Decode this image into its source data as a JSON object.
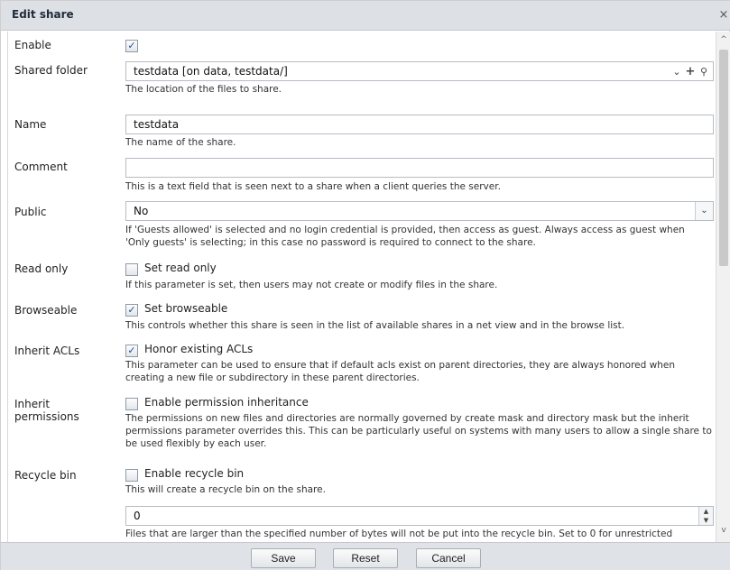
{
  "window": {
    "title": "Edit share",
    "close_glyph": "×"
  },
  "fields": {
    "enable": {
      "label": "Enable",
      "checked": true
    },
    "shared_folder": {
      "label": "Shared folder",
      "value": "testdata [on data, testdata/]",
      "help": "The location of the files to share.",
      "icons": [
        "chevron-down-icon",
        "plus-icon",
        "search-icon"
      ]
    },
    "name": {
      "label": "Name",
      "value": "testdata",
      "help": "The name of the share."
    },
    "comment": {
      "label": "Comment",
      "value": "",
      "help": "This is a text field that is seen next to a share when a client queries the server."
    },
    "public": {
      "label": "Public",
      "value": "No",
      "help": "If 'Guests allowed' is selected and no login credential is provided, then access as guest. Always access as guest when 'Only guests' is selecting; in this case no password is required to connect to the share."
    },
    "read_only": {
      "label": "Read only",
      "checkbox_label": "Set read only",
      "checked": false,
      "help": "If this parameter is set, then users may not create or modify files in the share."
    },
    "browseable": {
      "label": "Browseable",
      "checkbox_label": "Set browseable",
      "checked": true,
      "help": "This controls whether this share is seen in the list of available shares in a net view and in the browse list."
    },
    "inherit_acls": {
      "label": "Inherit ACLs",
      "checkbox_label": "Honor existing ACLs",
      "checked": true,
      "help": "This parameter can be used to ensure that if default acls exist on parent directories, they are always honored when creating a new file or subdirectory in these parent directories."
    },
    "inherit_permissions": {
      "label_line1": "Inherit",
      "label_line2": "permissions",
      "checkbox_label": "Enable permission inheritance",
      "checked": false,
      "help": "The permissions on new files and directories are normally governed by create mask and directory mask but the inherit permissions parameter overrides this. This can be particularly useful on systems with many users to allow a single share to be used flexibly by each user."
    },
    "recycle_bin": {
      "label": "Recycle bin",
      "checkbox_label": "Enable recycle bin",
      "checked": false,
      "help": "This will create a recycle bin on the share."
    },
    "max_size": {
      "value": "0",
      "help": "Files that are larger than the specified number of bytes will not be put into the recycle bin. Set to 0 for unrestricted"
    }
  },
  "footer": {
    "save": "Save",
    "reset": "Reset",
    "cancel": "Cancel"
  },
  "glyphs": {
    "check": "✓",
    "down": "⌄",
    "up_small": "▲",
    "down_small": "▼",
    "plus": "+",
    "search": "⚲",
    "scroll_up": "^",
    "scroll_down": "v"
  },
  "colors": {
    "titlebar": "#dde0e4",
    "footer": "#dfe2e6",
    "check": "#1f4e92"
  }
}
